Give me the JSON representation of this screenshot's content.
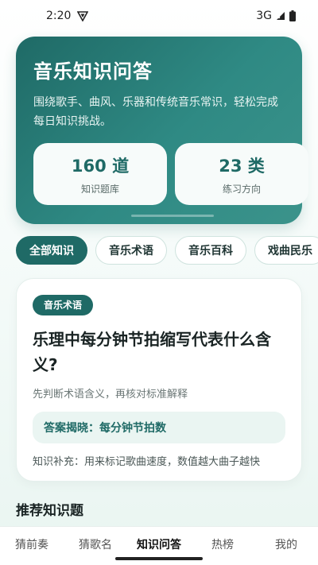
{
  "status_bar": {
    "time": "2:20",
    "network": "3G",
    "icons": [
      "vpn-icon",
      "signal-icon",
      "battery-icon"
    ]
  },
  "hero": {
    "title": "音乐知识问答",
    "description": "围绕歌手、曲风、乐器和传统音乐常识，轻松完成每日知识挑战。",
    "stats": [
      {
        "value": "160 道",
        "label": "知识题库"
      },
      {
        "value": "23 类",
        "label": "练习方向"
      }
    ]
  },
  "categories": {
    "selected": "全部知识",
    "items": [
      "全部知识",
      "音乐术语",
      "音乐百科",
      "戏曲民乐"
    ]
  },
  "question": {
    "tag": "音乐术语",
    "title": "乐理中每分钟节拍缩写代表什么含义?",
    "hint": "先判断术语含义，再核对标准解释",
    "answer": "答案揭晓：每分钟节拍数",
    "extra": "知识补充：用来标记歌曲速度，数值越大曲子越快"
  },
  "recommended": {
    "title": "推荐知识题"
  },
  "bottom_nav": {
    "active": "知识问答",
    "items": [
      "猜前奏",
      "猜歌名",
      "知识问答",
      "热榜",
      "我的"
    ]
  },
  "colors": {
    "primary": "#1f6a66",
    "primary_light": "#3b938b",
    "chip_border": "#cfe3de",
    "answer_bg": "#eaf5f2"
  }
}
